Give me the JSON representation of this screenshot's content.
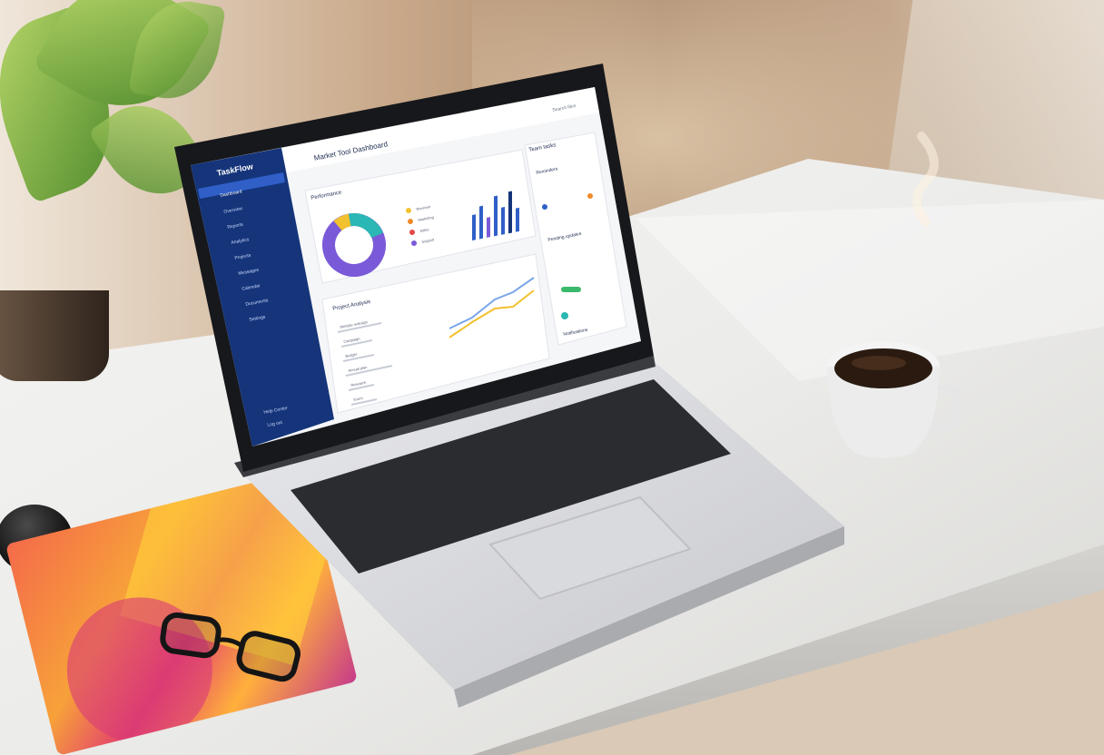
{
  "laptop_screen": {
    "brand": "TaskFlow",
    "header_title": "Market Tool Dashboard",
    "header_right": "Search files",
    "sidebar": {
      "items": [
        {
          "label": "Dashboard",
          "icon": "home-icon"
        },
        {
          "label": "Overview",
          "icon": "grid-icon"
        },
        {
          "label": "Reports",
          "icon": "chart-icon"
        },
        {
          "label": "Analytics",
          "icon": "pie-icon"
        },
        {
          "label": "Projects",
          "icon": "folder-icon"
        },
        {
          "label": "Messages",
          "icon": "mail-icon"
        },
        {
          "label": "Calendar",
          "icon": "calendar-icon"
        },
        {
          "label": "Documents",
          "icon": "file-icon"
        },
        {
          "label": "Settings",
          "icon": "gear-icon"
        }
      ],
      "footer": [
        "Help Center",
        "Log out"
      ]
    },
    "card_performance": {
      "title": "Performance",
      "legend": [
        "Revenue",
        "Marketing",
        "Sales",
        "Support"
      ],
      "legend_colors": [
        "#f2c12e",
        "#f08a2b",
        "#e44848",
        "#7a5ad8"
      ]
    },
    "card_projects": {
      "title": "Project Analysis",
      "rows": [
        "Website redesign",
        "Campaign",
        "Budget",
        "Annual plan",
        "Research",
        "Event"
      ]
    },
    "right_panel": {
      "title": "Team tasks",
      "sub1": "Reminders",
      "sub2": "Pending updates",
      "sub3": "Notifications"
    },
    "colors": {
      "sidebar": "#15347a",
      "accent": "#2f5fc7",
      "pie_purple": "#7a5ad8",
      "pie_teal": "#2bb7b3",
      "pie_yellow": "#f2c12e",
      "bar_blue": "#2f5fc7"
    }
  }
}
